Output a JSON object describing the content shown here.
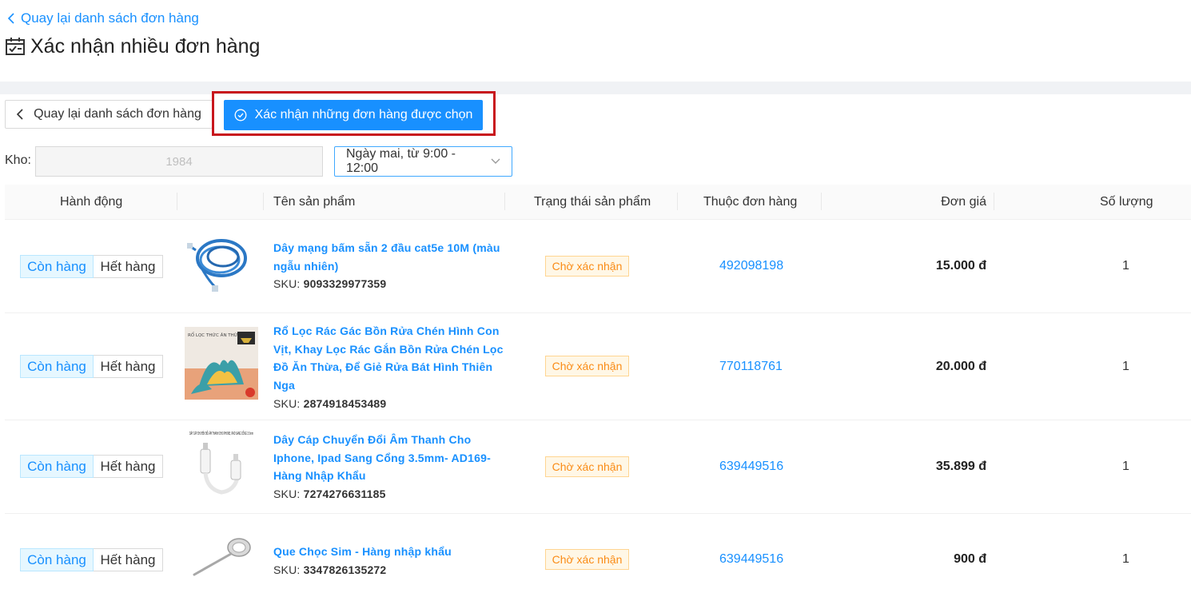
{
  "header": {
    "back_link": "Quay lại danh sách đơn hàng",
    "title": "Xác nhận nhiều đơn hàng"
  },
  "toolbar": {
    "back_button": "Quay lại danh sách đơn hàng",
    "confirm_button": "Xác nhận những đơn hàng được chọn"
  },
  "filters": {
    "warehouse_label": "Kho:",
    "warehouse_value": "1984",
    "time_slot": "Ngày mai, từ 9:00 - 12:00"
  },
  "table": {
    "columns": [
      "Hành động",
      "Tên sản phẩm",
      "Trạng thái sản phẩm",
      "Thuộc đơn hàng",
      "Đơn giá",
      "Số lượng"
    ],
    "in_stock_label": "Còn hàng",
    "out_of_stock_label": "Hết hàng",
    "sku_label": "SKU:",
    "rows": [
      {
        "name": "Dây mạng bấm sẵn 2 đầu cat5e 10M (màu ngẫu nhiên)",
        "sku": "9093329977359",
        "status": "Chờ xác nhận",
        "order": "492098198",
        "price": "15.000 đ",
        "qty": "1",
        "thumb": "blue-cable-image"
      },
      {
        "name": "Rổ Lọc Rác Gác Bồn Rửa Chén Hình Con Vịt, Khay Lọc Rác Gắn Bồn Rửa Chén Lọc Đồ Ăn Thừa, Để Giẻ Rửa Bát Hình Thiên Nga",
        "sku": "2874918453489",
        "status": "Chờ xác nhận",
        "order": "770118761",
        "price": "20.000 đ",
        "qty": "1",
        "thumb": "sink-strainer-image",
        "thumb_caption": "RỔ LỌC THỨC ĂN THỪA"
      },
      {
        "name": "Dây Cáp Chuyển Đổi Âm Thanh Cho Iphone, Ipad Sang Cổng 3.5mm- AD169- Hàng Nhập Khẩu",
        "sku": "7274276631185",
        "status": "Chờ xác nhận",
        "order": "639449516",
        "price": "35.899 đ",
        "qty": "1",
        "thumb": "audio-adapter-image",
        "thumb_caption": "DÂY CÁP CHUYỂN ĐỔI ÂM THANH CHO IPHONE, IPAD SANG CỔNG 3.5mm"
      },
      {
        "name": "Que Chọc Sim - Hàng nhập khẩu",
        "sku": "3347826135272",
        "status": "Chờ xác nhận",
        "order": "639449516",
        "price": "900 đ",
        "qty": "1",
        "thumb": "sim-ejector-image"
      }
    ]
  },
  "colors": {
    "primary": "#1890ff",
    "highlight": "#c8161d",
    "status_warning": "#fa8c16"
  }
}
